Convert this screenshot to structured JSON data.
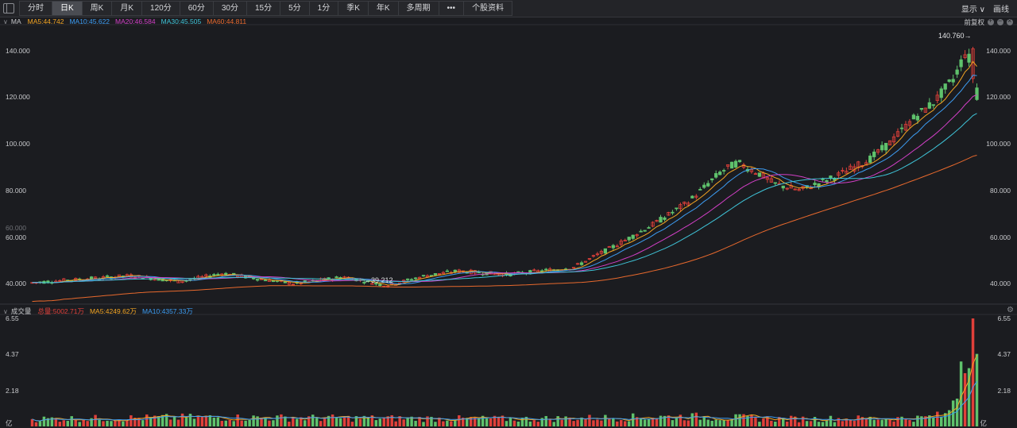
{
  "toolbar": {
    "tabs": [
      "分时",
      "日K",
      "周K",
      "月K",
      "120分",
      "60分",
      "30分",
      "15分",
      "5分",
      "1分",
      "季K",
      "年K",
      "多周期",
      "•••",
      "个股资料"
    ],
    "active_tab": 1,
    "right": {
      "display_label": "显示 ∨",
      "draw_label": "画线"
    }
  },
  "main_legend": {
    "label": "MA",
    "items": [
      {
        "text": "MA5:44.742",
        "color": "#f5a623"
      },
      {
        "text": "MA10:45.622",
        "color": "#3d9df3"
      },
      {
        "text": "MA20:46.584",
        "color": "#d23fc6"
      },
      {
        "text": "MA30:45.505",
        "color": "#3fc4d8"
      },
      {
        "text": "MA60:44.811",
        "color": "#e8692d"
      }
    ],
    "adjust_label": "前复权"
  },
  "price_axis": {
    "ticks": [
      "140.000",
      "120.000",
      "100.000",
      "80.000",
      "60.000",
      "40.000"
    ],
    "left_overlay": "60.000"
  },
  "annotations": {
    "high": "140.760→",
    "low": "←39.212"
  },
  "volume_legend": {
    "label": "成交量",
    "items": [
      {
        "text": "总量:5002.71万",
        "color": "#e0403a"
      },
      {
        "text": "MA5:4249.62万",
        "color": "#f5a623"
      },
      {
        "text": "MA10:4357.33万",
        "color": "#3d9df3"
      }
    ]
  },
  "volume_axis": {
    "ticks": [
      "6.55",
      "4.37",
      "2.18"
    ],
    "unit": "亿"
  },
  "colors": {
    "up": "#e0403a",
    "down": "#5fc26c",
    "background": "#1b1c20"
  },
  "chart_data": {
    "type": "candlestick",
    "x_count": 240,
    "price_ylim": [
      32,
      145
    ],
    "price_path": [
      [
        0,
        40.5
      ],
      [
        30,
        43.5
      ],
      [
        45,
        41
      ],
      [
        58,
        44.5
      ],
      [
        70,
        42
      ],
      [
        80,
        40
      ],
      [
        95,
        43
      ],
      [
        108,
        39.2
      ],
      [
        120,
        43.5
      ],
      [
        130,
        45.5
      ],
      [
        145,
        44
      ],
      [
        165,
        47
      ],
      [
        180,
        58
      ],
      [
        190,
        66
      ],
      [
        200,
        75
      ],
      [
        210,
        88
      ],
      [
        215,
        92
      ],
      [
        222,
        87
      ],
      [
        226,
        83
      ],
      [
        234,
        80
      ],
      [
        245,
        86
      ],
      [
        255,
        93
      ],
      [
        262,
        101
      ],
      [
        268,
        110
      ],
      [
        275,
        118
      ],
      [
        281,
        128
      ],
      [
        285,
        140.76
      ],
      [
        288,
        119
      ]
    ],
    "volume_ylim": [
      0,
      6.55
    ],
    "volume_path": [
      [
        0,
        0.45
      ],
      [
        50,
        0.55
      ],
      [
        100,
        0.5
      ],
      [
        150,
        0.45
      ],
      [
        200,
        0.6
      ],
      [
        230,
        0.45
      ],
      [
        270,
        0.5
      ],
      [
        279,
        0.7
      ],
      [
        282,
        2.6
      ],
      [
        285,
        6.55
      ],
      [
        288,
        4.4
      ]
    ]
  },
  "icons": [
    "sidebar-toggle-icon",
    "plus-icon",
    "minus-icon",
    "close-icon",
    "gear-icon"
  ]
}
